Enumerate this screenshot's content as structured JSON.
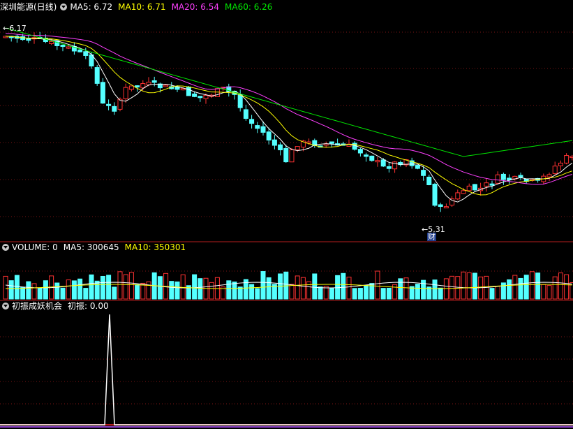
{
  "main": {
    "title": "深圳能源(日线)",
    "ma5": "MA5: 6.72",
    "ma10": "MA10: 6.71",
    "ma20": "MA20: 6.54",
    "ma60": "MA60: 6.26",
    "high_label": "6.17",
    "low_label": "5.31",
    "cai_badge": "财"
  },
  "volume": {
    "title": "VOLUME: 0",
    "ma5": "MA5: 300645",
    "ma10": "MA10: 350301"
  },
  "indicator": {
    "title": "初振成妖机会",
    "value": "初振: 0.00"
  },
  "colors": {
    "up": "#ff3232",
    "down": "#54ffff",
    "ma5": "#ffffff",
    "ma10": "#ffff00",
    "ma20": "#ff40ff",
    "ma60": "#00e600",
    "frame": "#b41e1e"
  }
}
